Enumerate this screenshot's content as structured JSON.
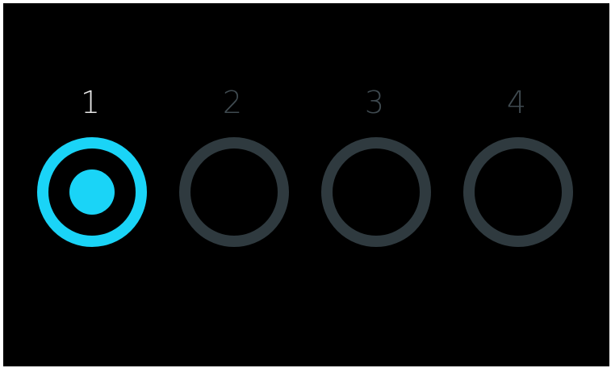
{
  "colors": {
    "background": "#000000",
    "frame": "#ffffff",
    "active_ring": "#1ad4f7",
    "inactive_ring": "#2f3a3f",
    "active_label": "#e6e6e6",
    "inactive_label": "#3f4a50"
  },
  "slots": [
    {
      "label": "1",
      "state": "active",
      "icon": "radio-selected-icon"
    },
    {
      "label": "2",
      "state": "inactive",
      "icon": "radio-empty-icon"
    },
    {
      "label": "3",
      "state": "inactive",
      "icon": "radio-empty-icon"
    },
    {
      "label": "4",
      "state": "inactive",
      "icon": "radio-empty-icon"
    }
  ]
}
